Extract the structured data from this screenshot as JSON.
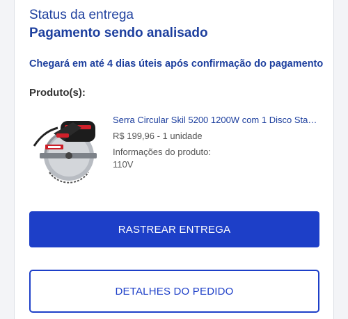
{
  "order_status": {
    "label": "Status da entrega",
    "value": "Pagamento sendo analisado",
    "delivery_note": "Chegará em até 4 dias úteis após confirmação do pagamento"
  },
  "products": {
    "title": "Produto(s):",
    "items": [
      {
        "name": "Serra Circular Skil 5200 1200W com 1 Disco Stand...",
        "price": "R$ 199,96 - 1 unidade",
        "info_label": "Informações do produto:",
        "info_value": "110V",
        "image_icon": "circular-saw-image"
      }
    ]
  },
  "actions": {
    "track_label": "RASTREAR ENTREGA",
    "details_label": "DETALHES DO PEDIDO"
  },
  "colors": {
    "brand_blue": "#1d3fc8",
    "heading_blue": "#1d3f9e"
  }
}
